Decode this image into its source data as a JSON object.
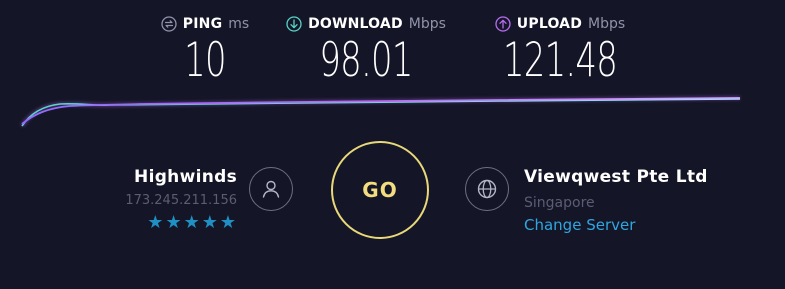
{
  "metrics": {
    "ping": {
      "icon": "ping-icon",
      "label": "PING",
      "unit": "ms",
      "value": "10"
    },
    "download": {
      "icon": "download-arrow-icon",
      "label": "DOWNLOAD",
      "unit": "Mbps",
      "value": "98.01"
    },
    "upload": {
      "icon": "upload-arrow-icon",
      "label": "UPLOAD",
      "unit": "Mbps",
      "value": "121.48"
    }
  },
  "isp": {
    "name": "Highwinds",
    "ip": "173.245.211.156",
    "rating": 5,
    "rating_max": 5,
    "icon": "user-icon"
  },
  "go": {
    "label": "GO"
  },
  "server": {
    "name": "Viewqwest Pte Ltd",
    "location": "Singapore",
    "change_label": "Change Server",
    "icon": "globe-icon"
  },
  "colors": {
    "background": "#141526",
    "ping": "#9193a8",
    "download": "#56d4c8",
    "upload": "#b86cf0",
    "go_ring": "#e8d87a",
    "star": "#1f8fc4",
    "link": "#2fa6e2"
  }
}
